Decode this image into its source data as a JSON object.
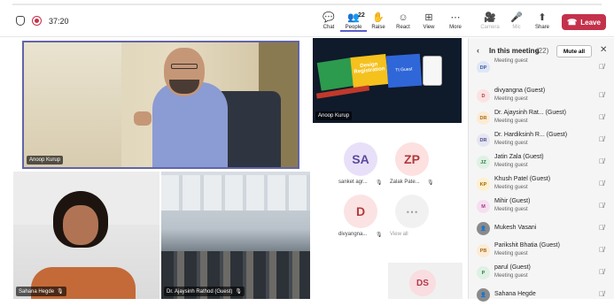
{
  "toolbar": {
    "timer": "37:20",
    "buttons": [
      {
        "label": "Chat",
        "icon": "chat-icon",
        "glyph": "💬"
      },
      {
        "label": "People",
        "icon": "people-icon",
        "glyph": "👥",
        "badge": "22"
      },
      {
        "label": "Raise",
        "icon": "raise-hand-icon",
        "glyph": "✋"
      },
      {
        "label": "React",
        "icon": "react-icon",
        "glyph": "☺"
      },
      {
        "label": "View",
        "icon": "view-icon",
        "glyph": "⊞"
      },
      {
        "label": "More",
        "icon": "more-icon",
        "glyph": "⋯"
      },
      {
        "label": "Camera",
        "icon": "camera-off-icon",
        "glyph": "🎥"
      },
      {
        "label": "Mic",
        "icon": "mic-off-icon",
        "glyph": "🎤"
      },
      {
        "label": "Share",
        "icon": "share-icon",
        "glyph": "⬆"
      }
    ],
    "leave_label": "Leave"
  },
  "stage": {
    "main_speaker": "Anoop Kurup",
    "shared_screen_name": "Anoop Kurup",
    "slide_text": [
      "Design Registration",
      "Tt Guest"
    ],
    "tile_sahana": "Sahana Hegde",
    "tile_ajaysinh": "Dr. Ajaysinh Rathod (Guest)",
    "avatars": [
      {
        "initials": "SA",
        "label": "sanket agr...",
        "bg": "#e8e0f8",
        "fg": "#5b4a9c"
      },
      {
        "initials": "ZP",
        "label": "Zalak Pate...",
        "bg": "#fde0e0",
        "fg": "#b03a3a"
      },
      {
        "initials": "D",
        "label": "divyangna...",
        "bg": "#fbe3e3",
        "fg": "#b33b3b"
      },
      {
        "initials": "⋯",
        "label": "View all",
        "bg": "#f1f1f1",
        "fg": "#9a9a9a"
      }
    ],
    "bottom_tile_initials": "DS"
  },
  "panel": {
    "title": "In this meeting",
    "count": "(22)",
    "mute_all_label": "Mute all",
    "participants": [
      {
        "initials": "DP",
        "name": "",
        "role": "Meeting guest",
        "bg": "#dfe6f6",
        "fg": "#3a5aa0"
      },
      {
        "initials": "D",
        "name": "divyangna (Guest)",
        "role": "Meeting guest",
        "bg": "#fbe3e3",
        "fg": "#b33b3b"
      },
      {
        "initials": "DR",
        "name": "Dr. Ajaysinh Rat... (Guest)",
        "role": "Meeting guest",
        "bg": "#fdebd5",
        "fg": "#a66a16"
      },
      {
        "initials": "DR",
        "name": "Dr. Hardiksinh R... (Guest)",
        "role": "Meeting guest",
        "bg": "#e6e6f3",
        "fg": "#4b4b8a"
      },
      {
        "initials": "JZ",
        "name": "Jatin Zala (Guest)",
        "role": "Meeting guest",
        "bg": "#dff1e4",
        "fg": "#2f7a44"
      },
      {
        "initials": "KP",
        "name": "Khush Patel (Guest)",
        "role": "Meeting guest",
        "bg": "#fff0d0",
        "fg": "#a06a00"
      },
      {
        "initials": "M",
        "name": "Mihir (Guest)",
        "role": "Meeting guest",
        "bg": "#f6dff0",
        "fg": "#9a3a80"
      },
      {
        "initials": "",
        "name": "Mukesh Vasani",
        "role": "",
        "bg": "#8a8a8a",
        "fg": "#ffffff"
      },
      {
        "initials": "PB",
        "name": "Parikshit Bhatia (Guest)",
        "role": "Meeting guest",
        "bg": "#fdebd5",
        "fg": "#a66a16"
      },
      {
        "initials": "P",
        "name": "parul (Guest)",
        "role": "Meeting guest",
        "bg": "#dff1e4",
        "fg": "#2f7a44"
      },
      {
        "initials": "",
        "name": "Sahana Hegde",
        "role": "",
        "bg": "#8a8a8a",
        "fg": "#ffffff"
      }
    ]
  },
  "colors": {
    "accent": "#5b5fc7",
    "leave": "#c4314b"
  }
}
